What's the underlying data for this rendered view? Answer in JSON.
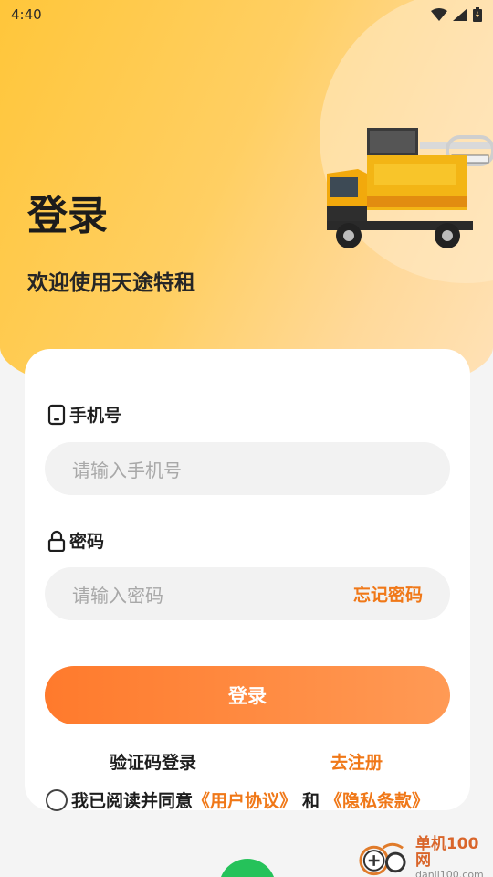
{
  "status_bar": {
    "time": "4:40"
  },
  "header": {
    "title": "登录",
    "subtitle": "欢迎使用天途特租"
  },
  "form": {
    "phone_label": "手机号",
    "phone_placeholder": "请输入手机号",
    "password_label": "密码",
    "password_placeholder": "请输入密码",
    "forgot_label": "忘记密码",
    "login_button": "登录",
    "code_login": "验证码登录",
    "register": "去注册",
    "agree_prefix": "我已阅读并同意",
    "user_agreement": "《用户协议》",
    "agree_and": "和",
    "privacy_policy": "《隐私条款》"
  },
  "watermark": {
    "cn": "单机100网",
    "en": "danji100.com"
  },
  "colors": {
    "accent": "#f07818",
    "hero": "#ffc63a",
    "button": "#ff7a2c"
  }
}
